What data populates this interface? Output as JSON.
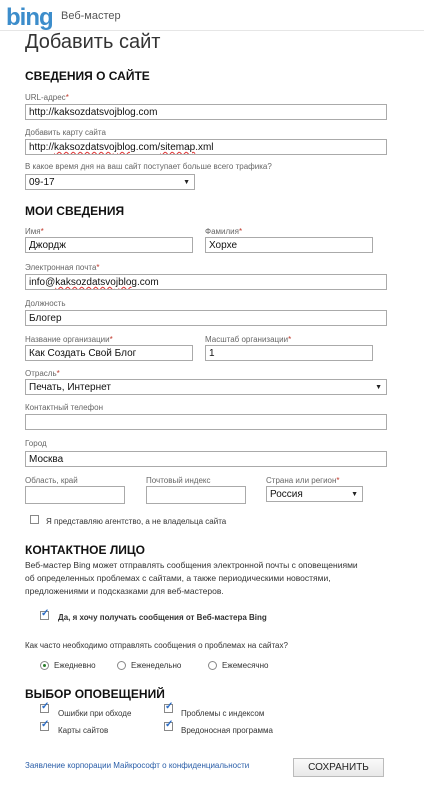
{
  "header": {
    "logo": "bing",
    "app": "Веб-мастер"
  },
  "page_title": "Добавить сайт",
  "site_section": {
    "title": "СВЕДЕНИЯ О САЙТЕ",
    "url_label": "URL-адрес",
    "url_value_prefix": "http://",
    "url_value_domain": "kaksozdatsvojblog",
    "url_value_suffix": ".com",
    "sitemap_label": "Добавить карту сайта",
    "sitemap_prefix": "http://",
    "sitemap_domain": "kaksozdatsvojblog",
    "sitemap_mid": ".com/",
    "sitemap_word": "sitemap",
    "sitemap_suffix": ".xml",
    "traffic_label": "В какое время дня на ваш сайт поступает больше всего трафика?",
    "traffic_value": "09-17"
  },
  "my_section": {
    "title": "МОИ СВЕДЕНИЯ",
    "first_name_label": "Имя",
    "first_name_value": "Джордж",
    "last_name_label": "Фамилия",
    "last_name_value": "Хорхе",
    "email_label": "Электронная почта",
    "email_prefix": "info@",
    "email_domain": "kaksozdatsvojblog",
    "email_suffix": ".com",
    "position_label": "Должность",
    "position_value": "Блогер",
    "org_label": "Название организации",
    "org_value": "Как Создать Свой Блог",
    "scale_label": "Масштаб организации",
    "scale_value": "1",
    "industry_label": "Отрасль",
    "industry_value": "Печать, Интернет",
    "phone_label": "Контактный телефон",
    "phone_value": "",
    "city_label": "Город",
    "city_value": "Москва",
    "region_label": "Область, край",
    "region_value": "",
    "zip_label": "Почтовый индекс",
    "zip_value": "",
    "country_label": "Страна или регион",
    "country_value": "Россия",
    "agency_label": "Я представляю агентство, а не владельца сайта"
  },
  "contact_section": {
    "title": "КОНТАКТНОЕ ЛИЦО",
    "paragraph_1": "Веб-мастер Bing может отправлять сообщения электронной почты с оповещениями",
    "paragraph_2": "об определенных проблемах с сайтами, а также периодическими новостями,",
    "paragraph_3": "предложениями и подсказками для веб-мастеров.",
    "optin_label": "Да, я хочу получать сообщения от Веб-мастера Bing",
    "frequency_question": "Как часто необходимо отправлять сообщения о проблемах на сайтах?",
    "freq_daily": "Ежедневно",
    "freq_weekly": "Еженедельно",
    "freq_monthly": "Ежемесячно"
  },
  "alerts_section": {
    "title": "ВЫБОР ОПОВЕЩЕНИЙ",
    "crawl_errors": "Ошибки при обходе",
    "index_problems": "Проблемы с индексом",
    "sitemaps": "Карты сайтов",
    "malware": "Вредоносная программа"
  },
  "footer": {
    "privacy_link": "Заявление корпорации Майкрософт о конфиденциальности",
    "save_button": "СОХРАНИТЬ"
  },
  "colors": {
    "brand": "#3c8dcb",
    "required": "#c0392b",
    "link": "#2a5ea8"
  }
}
